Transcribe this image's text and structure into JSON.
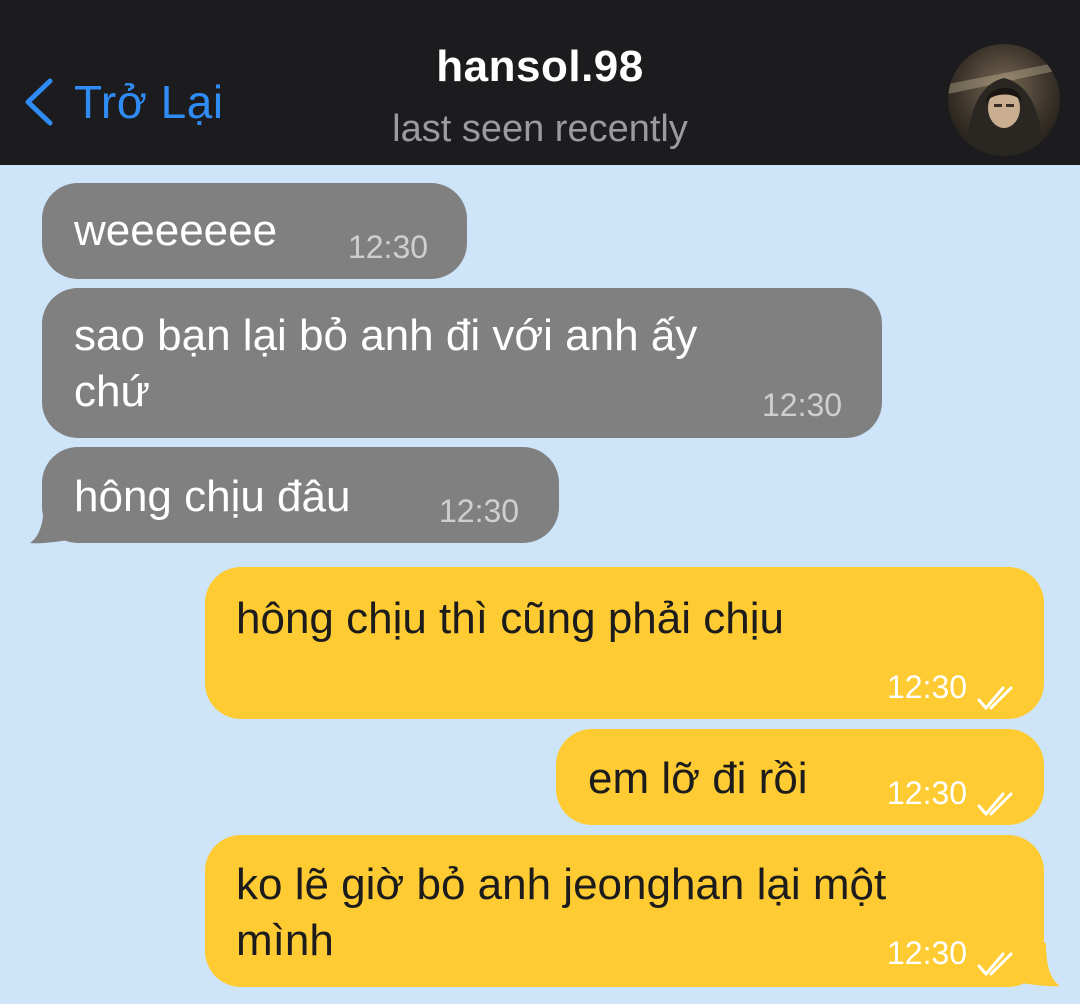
{
  "header": {
    "back_label": "Trở Lại",
    "contact_name": "hansol.98",
    "status": "last seen recently"
  },
  "colors": {
    "header_bg": "#1C1C1E",
    "accent": "#2F8CF5",
    "chat_bg": "#CEE4F8",
    "incoming_bubble": "#808080",
    "outgoing_bubble": "#FFCB32"
  },
  "messages": [
    {
      "direction": "incoming",
      "text": "weeeeeee",
      "time": "12:30"
    },
    {
      "direction": "incoming",
      "text": "sao bạn lại bỏ anh đi với anh ấy\nchứ",
      "time": "12:30"
    },
    {
      "direction": "incoming",
      "text": "hông chịu đâu",
      "time": "12:30"
    },
    {
      "direction": "outgoing",
      "text": "hông chịu thì cũng phải chịu",
      "time": "12:30",
      "read": true
    },
    {
      "direction": "outgoing",
      "text": "em lỡ đi rồi",
      "time": "12:30",
      "read": true
    },
    {
      "direction": "outgoing",
      "text": "ko lẽ giờ bỏ anh jeonghan lại một\nmình",
      "time": "12:30",
      "read": true
    }
  ]
}
